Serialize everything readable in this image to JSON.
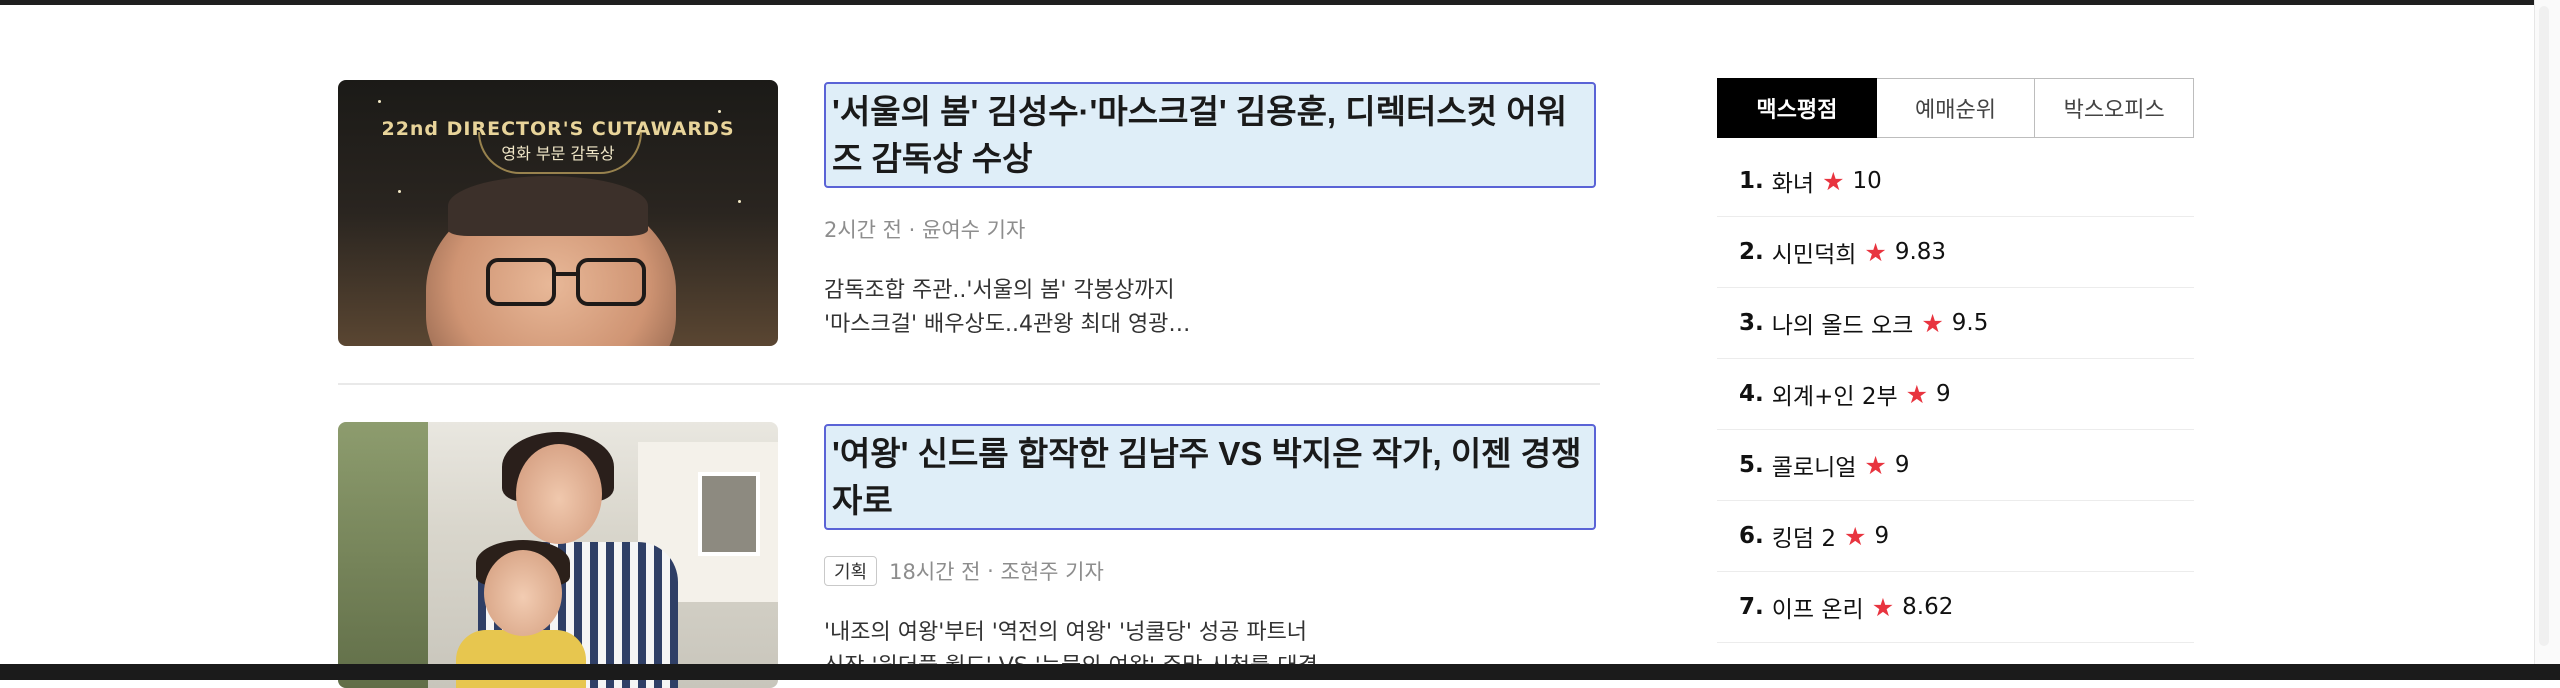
{
  "articles": [
    {
      "headline": "'서울의 봄' 김성수·'마스크걸' 김용훈, 디렉터스컷 어워즈 감독상 수상",
      "time": "2시간 전",
      "reporter": "윤여수 기자",
      "summary_lines": [
        "감독조합 주관..'서울의 봄' 각봉상까지",
        "'마스크걸' 배우상도..4관왕 최대 영광…"
      ],
      "thumb": {
        "award_title": "22nd DIRECTOR'S CUTAWARDS",
        "award_sub": "영화 부문 감독상"
      }
    },
    {
      "headline": "'여왕' 신드롬 합작한 김남주 VS 박지은 작가, 이젠 경쟁자로",
      "tag": "기획",
      "time": "18시간 전",
      "reporter": "조현주 기자",
      "summary_lines": [
        "'내조의 여왕'부터 '역전의 여왕' '넝쿨당' 성공 파트너",
        "신작 '원더풀 월드' VS '눈물의 여왕' 주말 시청률 대결"
      ]
    }
  ],
  "ranking": {
    "tabs": [
      "맥스평점",
      "예매순위",
      "박스오피스"
    ],
    "active_tab": 0,
    "items": [
      {
        "rank": "1.",
        "title": "화녀",
        "score": "10"
      },
      {
        "rank": "2.",
        "title": "시민덕희",
        "score": "9.83"
      },
      {
        "rank": "3.",
        "title": "나의 올드 오크",
        "score": "9.5"
      },
      {
        "rank": "4.",
        "title": "외계+인 2부",
        "score": "9"
      },
      {
        "rank": "5.",
        "title": "콜로니얼",
        "score": "9"
      },
      {
        "rank": "6.",
        "title": "킹덤 2",
        "score": "9"
      },
      {
        "rank": "7.",
        "title": "이프 온리",
        "score": "8.62"
      }
    ],
    "star_icon": "star-icon",
    "star_color": "#e8343f"
  },
  "colors": {
    "headline_highlight": "#dfeef8",
    "headline_border": "#5a63d6",
    "active_tab_bg": "#000000"
  }
}
